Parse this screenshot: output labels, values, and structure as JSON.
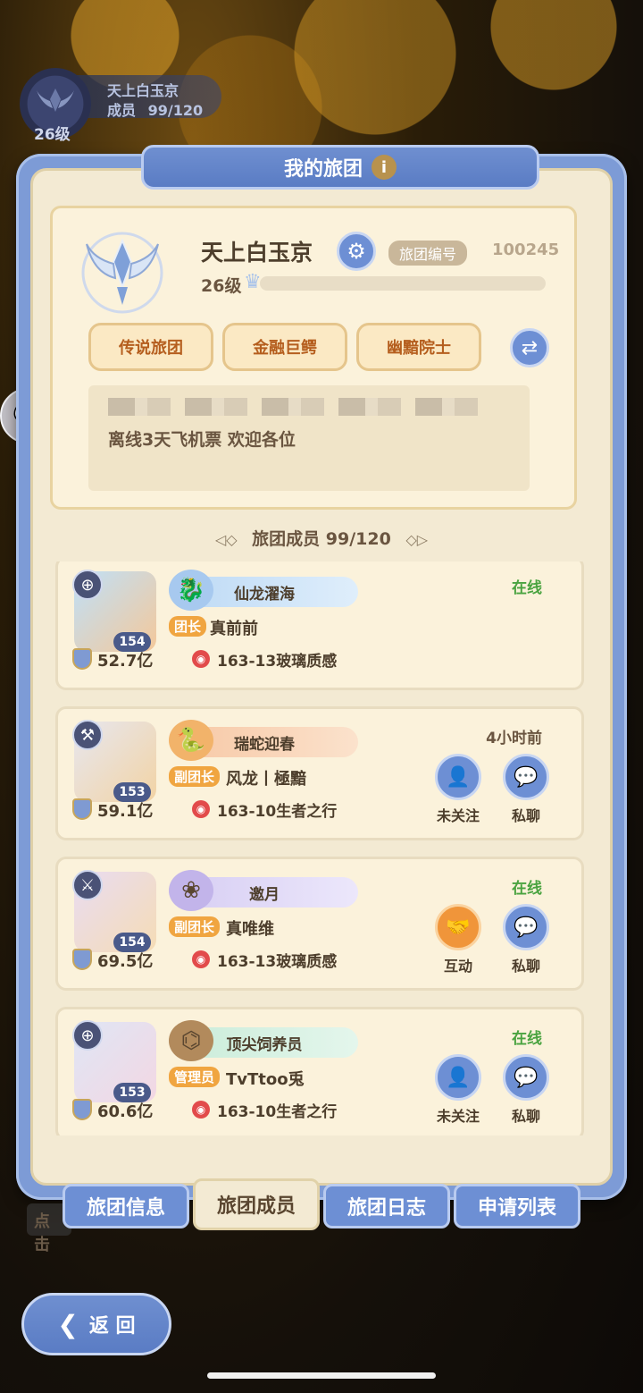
{
  "top_badge": {
    "level": "26级",
    "guild_name": "天上白玉京",
    "members_label": "成员",
    "members_value": "99/120"
  },
  "panel": {
    "title": "我的旅团"
  },
  "guild": {
    "name": "天上白玉京",
    "id_label": "旅团编号",
    "id_value": "100245",
    "level": "26级",
    "exp_progress": 0.0,
    "tags": [
      "传说旅团",
      "金融巨鳄",
      "幽黯院士"
    ],
    "notice_text": "离线3天飞机票 欢迎各位"
  },
  "members_header": {
    "label": "旅团成员",
    "count": "99/120"
  },
  "members": [
    {
      "level": "154",
      "title": "仙龙濯海",
      "role": "团长",
      "name": "真前前",
      "power": "52.7亿",
      "location": "163-13玻璃质感",
      "status": "在线",
      "actions": []
    },
    {
      "level": "153",
      "title": "瑞蛇迎春",
      "role": "副团长",
      "name": "风龙丨極黯",
      "power": "59.1亿",
      "location": "163-10生者之行",
      "status": "4小时前",
      "actions": [
        "未关注",
        "私聊"
      ]
    },
    {
      "level": "154",
      "title": "邀月",
      "role": "副团长",
      "name": "真唯维",
      "power": "69.5亿",
      "location": "163-13玻璃质感",
      "status": "在线",
      "actions": [
        "互动",
        "私聊"
      ]
    },
    {
      "level": "153",
      "title": "顶尖饲养员",
      "role": "管理员",
      "name": "TvTtoo兎",
      "power": "60.6亿",
      "location": "163-10生者之行",
      "status": "在线",
      "actions": [
        "未关注",
        "私聊"
      ]
    }
  ],
  "tabs": [
    "旅团信息",
    "旅团成员",
    "旅团日志",
    "申请列表"
  ],
  "active_tab": "旅团成员",
  "back": {
    "label": "返 回"
  },
  "obscured": "点击",
  "colors": {
    "panel_blue": "#7d9bd6",
    "parchment": "#f3ead3",
    "online_green": "#4aa340",
    "tag_orange": "#b55e1e"
  }
}
